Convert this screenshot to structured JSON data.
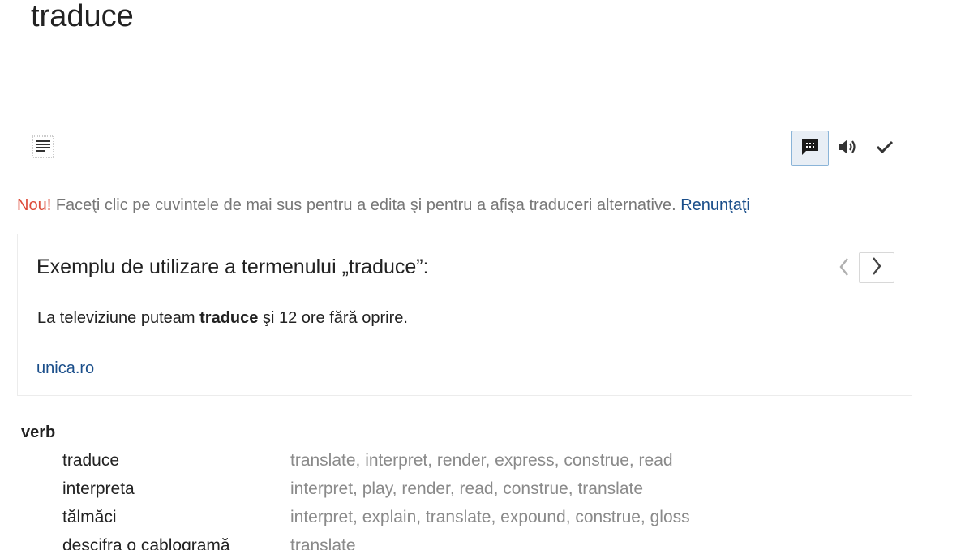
{
  "result": {
    "translated_word": "traduce"
  },
  "toolbar": {
    "left_icon": "list-icon",
    "right_icons": [
      "feedback-icon",
      "speaker-icon",
      "checkmark-icon"
    ]
  },
  "notice": {
    "new_label": "Nou!",
    "message": "Faceţi clic pe cuvintele de mai sus pentru a edita şi pentru a afişa traduceri alternative.",
    "dismiss_label": "Renunţaţi"
  },
  "example": {
    "title": "Exemplu de utilizare a termenului „traduce”:",
    "sentence_before": "La televiziune puteam ",
    "sentence_bold": "traduce",
    "sentence_after": " şi 12 ore fără oprire.",
    "source": "unica.ro"
  },
  "dictionary": {
    "pos": "verb",
    "entries": [
      {
        "term": "traduce",
        "translations": "translate, interpret, render, express, construe, read"
      },
      {
        "term": "interpreta",
        "translations": "interpret, play, render, read, construe, translate"
      },
      {
        "term": "tălmăci",
        "translations": "interpret, explain, translate, expound, construe, gloss"
      },
      {
        "term": "descifra o cablogramă",
        "translations": "translate"
      }
    ]
  },
  "colors": {
    "accent_link": "#1a4e8a",
    "new_label": "#dd4b39",
    "muted_text": "#777777"
  }
}
